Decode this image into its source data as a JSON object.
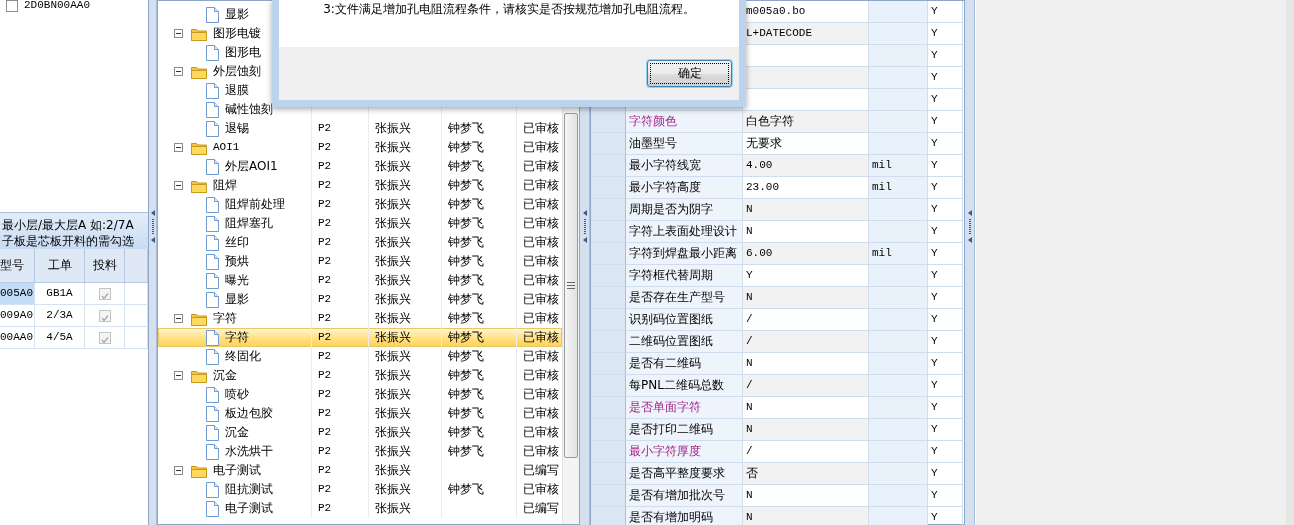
{
  "model_list": {
    "items": [
      {
        "label": "2D0BN00AA0",
        "checked": false
      }
    ]
  },
  "hint_lines": [
    "最小层/最大层A 如:2/7A",
    "子板是芯板开料的需勾选"
  ],
  "orders": {
    "columns": [
      "型号",
      "工单",
      "投料"
    ],
    "rows": [
      {
        "model": "005A0",
        "order": "GB1A",
        "issued": true,
        "disabled": true,
        "selected": true
      },
      {
        "model": "009A0",
        "order": "2/3A",
        "issued": true,
        "disabled": true,
        "selected": false
      },
      {
        "model": "00AA0",
        "order": "4/5A",
        "issued": true,
        "disabled": true,
        "selected": false
      }
    ]
  },
  "tree": {
    "nodes": [
      {
        "children": [
          {
            "label": "显影",
            "kind": "document",
            "selected": false
          }
        ]
      },
      {
        "label": "图形电镀",
        "kind": "folder",
        "expanded": true,
        "selected": false,
        "children": [
          {
            "label": "图形电",
            "kind": "document",
            "selected": false
          }
        ]
      },
      {
        "label": "外层蚀刻",
        "kind": "folder",
        "expanded": true,
        "selected": false,
        "children": [
          {
            "label": "退膜",
            "kind": "document",
            "selected": false
          },
          {
            "label": "碱性蚀刻",
            "kind": "document",
            "selected": false
          },
          {
            "label": "退锡",
            "kind": "document",
            "selected": false,
            "column_1": "P2",
            "column_2": "张振兴",
            "column_3": "钟梦飞",
            "column_4": "已审核"
          }
        ]
      },
      {
        "label": "AOI1",
        "kind": "folder",
        "expanded": true,
        "selected": false,
        "column_1": "P2",
        "column_2": "张振兴",
        "column_3": "钟梦飞",
        "column_4": "已审核",
        "children": [
          {
            "label": "外层AOI1",
            "kind": "document",
            "selected": false,
            "column_1": "P2",
            "column_2": "张振兴",
            "column_3": "钟梦飞",
            "column_4": "已审核"
          }
        ]
      },
      {
        "label": "阻焊",
        "kind": "folder",
        "expanded": true,
        "selected": false,
        "column_1": "P2",
        "column_2": "张振兴",
        "column_3": "钟梦飞",
        "column_4": "已审核",
        "children": [
          {
            "label": "阻焊前处理",
            "kind": "document",
            "selected": false,
            "column_1": "P2",
            "column_2": "张振兴",
            "column_3": "钟梦飞",
            "column_4": "已审核"
          },
          {
            "label": "阻焊塞孔",
            "kind": "document",
            "selected": false,
            "column_1": "P2",
            "column_2": "张振兴",
            "column_3": "钟梦飞",
            "column_4": "已审核"
          },
          {
            "label": "丝印",
            "kind": "document",
            "selected": false,
            "column_1": "P2",
            "column_2": "张振兴",
            "column_3": "钟梦飞",
            "column_4": "已审核"
          },
          {
            "label": "预烘",
            "kind": "document",
            "selected": false,
            "column_1": "P2",
            "column_2": "张振兴",
            "column_3": "钟梦飞",
            "column_4": "已审核"
          },
          {
            "label": "曝光",
            "kind": "document",
            "selected": false,
            "column_1": "P2",
            "column_2": "张振兴",
            "column_3": "钟梦飞",
            "column_4": "已审核"
          },
          {
            "label": "显影",
            "kind": "document",
            "selected": false,
            "column_1": "P2",
            "column_2": "张振兴",
            "column_3": "钟梦飞",
            "column_4": "已审核"
          }
        ]
      },
      {
        "label": "字符",
        "kind": "folder",
        "expanded": true,
        "selected": false,
        "column_1": "P2",
        "column_2": "张振兴",
        "column_3": "钟梦飞",
        "column_4": "已审核",
        "children": [
          {
            "label": "字符",
            "kind": "document",
            "selected": true,
            "column_1": "P2",
            "column_2": "张振兴",
            "column_3": "钟梦飞",
            "column_4": "已审核"
          },
          {
            "label": "终固化",
            "kind": "document",
            "selected": false,
            "column_1": "P2",
            "column_2": "张振兴",
            "column_3": "钟梦飞",
            "column_4": "已审核"
          }
        ]
      },
      {
        "label": "沉金",
        "kind": "folder",
        "expanded": true,
        "selected": false,
        "column_1": "P2",
        "column_2": "张振兴",
        "column_3": "钟梦飞",
        "column_4": "已审核",
        "children": [
          {
            "label": "喷砂",
            "kind": "document",
            "selected": false,
            "column_1": "P2",
            "column_2": "张振兴",
            "column_3": "钟梦飞",
            "column_4": "已审核"
          },
          {
            "label": "板边包胶",
            "kind": "document",
            "selected": false,
            "column_1": "P2",
            "column_2": "张振兴",
            "column_3": "钟梦飞",
            "column_4": "已审核"
          },
          {
            "label": "沉金",
            "kind": "document",
            "selected": false,
            "column_1": "P2",
            "column_2": "张振兴",
            "column_3": "钟梦飞",
            "column_4": "已审核"
          },
          {
            "label": "水洗烘干",
            "kind": "document",
            "selected": false,
            "column_1": "P2",
            "column_2": "张振兴",
            "column_3": "钟梦飞",
            "column_4": "已审核"
          }
        ]
      },
      {
        "label": "电子测试",
        "kind": "folder",
        "expanded": true,
        "selected": false,
        "column_1": "P2",
        "column_2": "张振兴",
        "column_4": "已编写",
        "children": [
          {
            "label": "阻抗测试",
            "kind": "document",
            "selected": false,
            "column_1": "P2",
            "column_2": "张振兴",
            "column_3": "钟梦飞",
            "column_4": "已审核"
          },
          {
            "label": "电子测试",
            "kind": "document",
            "selected": false,
            "column_1": "P2",
            "column_2": "张振兴",
            "column_4": "已编写"
          }
        ]
      }
    ]
  },
  "properties": {
    "rows": [
      {
        "value": "m005a0.bo",
        "flag": "Y"
      },
      {
        "value": "L+DATECODE",
        "flag": "Y"
      },
      {
        "flag": "Y"
      },
      {
        "flag": "Y"
      },
      {
        "flag": "Y"
      },
      {
        "name": "字符颜色",
        "value": "白色字符",
        "flag": "Y",
        "emphasized": true
      },
      {
        "name": "油墨型号",
        "value": "无要求",
        "flag": "Y",
        "emphasized": false
      },
      {
        "name": "最小字符线宽",
        "value": "4.00",
        "unit": "mil",
        "flag": "Y",
        "emphasized": false
      },
      {
        "name": "最小字符高度",
        "value": "23.00",
        "unit": "mil",
        "flag": "Y",
        "emphasized": false
      },
      {
        "name": "周期是否为阴字",
        "value": "N",
        "flag": "Y",
        "emphasized": false
      },
      {
        "name": "字符上表面处理设计",
        "value": "N",
        "flag": "Y",
        "emphasized": false
      },
      {
        "name": "字符到焊盘最小距离",
        "value": "6.00",
        "unit": "mil",
        "flag": "Y",
        "emphasized": false
      },
      {
        "name": "字符框代替周期",
        "value": "Y",
        "flag": "Y",
        "emphasized": false
      },
      {
        "name": "是否存在生产型号",
        "value": "N",
        "flag": "Y",
        "emphasized": false
      },
      {
        "name": "识别码位置图纸",
        "value": "/",
        "flag": "Y",
        "emphasized": false
      },
      {
        "name": "二维码位置图纸",
        "value": "/",
        "flag": "Y",
        "emphasized": false
      },
      {
        "name": "是否有二维码",
        "value": "N",
        "flag": "Y",
        "emphasized": false
      },
      {
        "name": "每PNL二维码总数",
        "value": "/",
        "flag": "Y",
        "emphasized": false
      },
      {
        "name": "是否单面字符",
        "value": "N",
        "flag": "Y",
        "emphasized": true
      },
      {
        "name": "是否打印二维码",
        "value": "N",
        "flag": "Y",
        "emphasized": false
      },
      {
        "name": "最小字符厚度",
        "value": "/",
        "flag": "Y",
        "emphasized": true
      },
      {
        "name": "是否高平整度要求",
        "value": "否",
        "flag": "Y",
        "emphasized": false
      },
      {
        "name": "是否有增加批次号",
        "value": "N",
        "flag": "Y",
        "emphasized": false
      },
      {
        "name": "是否有增加明码",
        "value": "N",
        "flag": "Y",
        "emphasized": false
      }
    ]
  },
  "dialog": {
    "message": "3:文件满足增加孔电阻流程条件，请核实是否按规范增加孔电阻流程。",
    "buttons": [
      {
        "label": "确定",
        "focused": true
      }
    ]
  }
}
